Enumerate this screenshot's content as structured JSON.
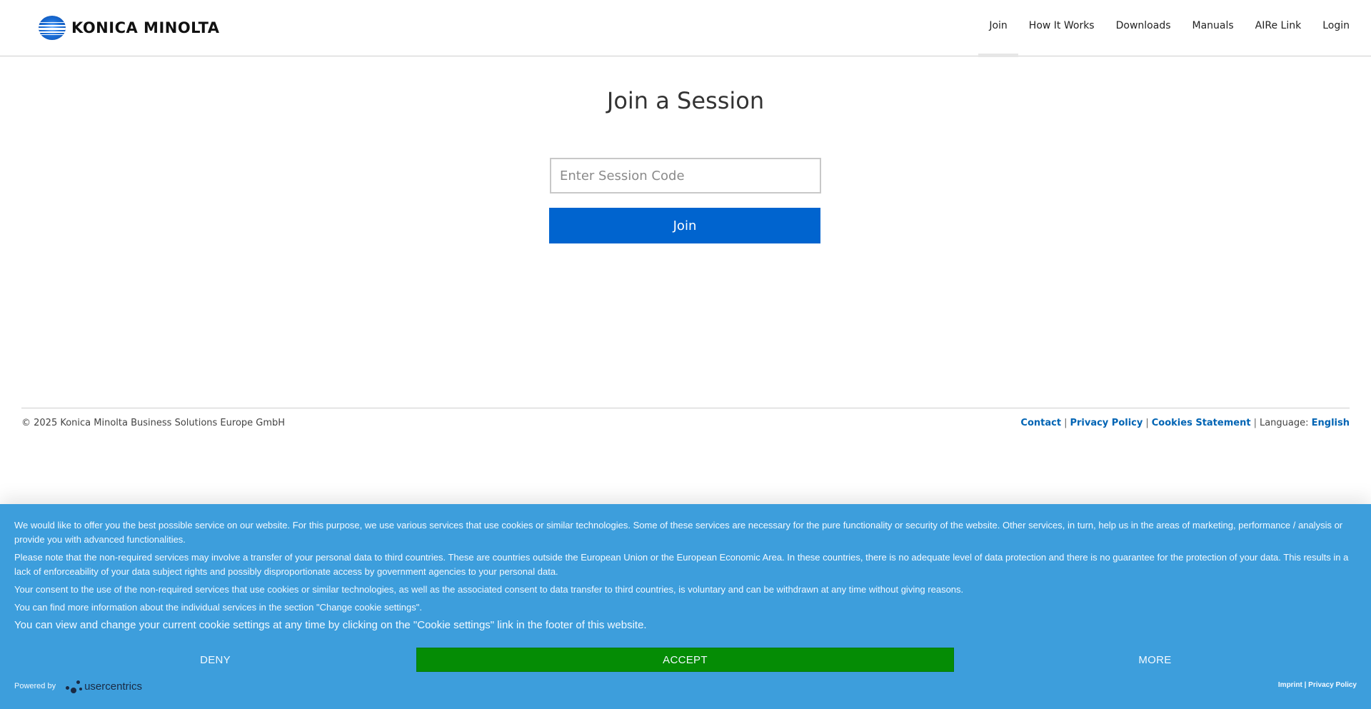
{
  "header": {
    "logo_text": "KONICA MINOLTA",
    "nav": [
      "Join",
      "How It Works",
      "Downloads",
      "Manuals",
      "AIRe Link",
      "Login"
    ],
    "active_nav": "Join"
  },
  "main": {
    "title": "Join a Session",
    "code_placeholder": "Enter Session Code",
    "join_label": "Join"
  },
  "footer": {
    "copyright": "© 2025 Konica Minolta Business Solutions Europe GmbH",
    "contact": "Contact",
    "privacy": "Privacy Policy",
    "cookies": "Cookies Statement",
    "language_label": "Language:",
    "language_value": "English",
    "separator": "|"
  },
  "cookie_banner": {
    "p1": "We would like to offer you the best possible service on our website. For this purpose, we use various services that use cookies or similar technologies. Some of these services are necessary for the pure functionality or security of the website. Other services, in turn, help us in the areas of marketing, performance / analysis or provide you with advanced functionalities.",
    "p2": "Please note that the non-required services may involve a transfer of your personal data to third countries. These are countries outside the European Union or the European Economic Area. In these countries, there is no adequate level of data protection and there is no guarantee for the protection of your data. This results in a lack of enforceability of your data subject rights and possibly disproportionate access by government agencies to your personal data.",
    "p3": "Your consent to the use of the non-required services that use cookies or similar technologies, as well as the associated consent to data transfer to third countries, is voluntary and can be withdrawn at any time without giving reasons.",
    "p4": "You can find more information about the individual services in the section \"Change cookie settings\".",
    "p5": "You can view and change your current cookie settings at any time by clicking on the \"Cookie settings\" link in the footer of this website.",
    "deny": "DENY",
    "accept": "ACCEPT",
    "more": "MORE",
    "powered_by": "Powered by",
    "brand": "usercentrics",
    "imprint": "Imprint",
    "privacy": "Privacy Policy",
    "accept_color": "#058c05",
    "banner_color": "#3d9edc"
  },
  "colors": {
    "primary_button": "#0064cf",
    "link": "#0064b4"
  }
}
